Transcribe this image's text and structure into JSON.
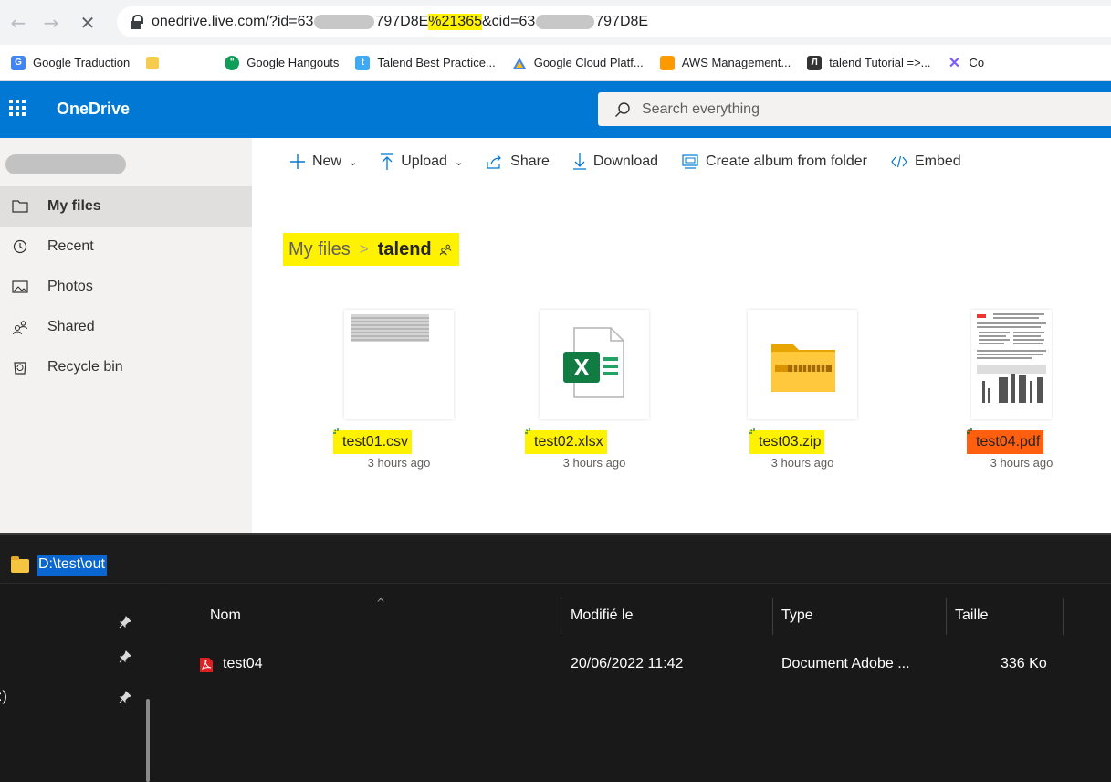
{
  "browser": {
    "url_parts": {
      "prefix": "onedrive.live.com/?id=63",
      "mid": "797D8E",
      "highlight": "%21365",
      "cid": "&cid=63",
      "tail": "797D8E"
    },
    "bookmarks": [
      {
        "label": "Google Traduction",
        "icon": "translate-icon",
        "color": "#4285f4"
      },
      {
        "label": "Google Hangouts",
        "icon": "hangouts-icon",
        "color": "#0f9d58"
      },
      {
        "label": "Talend Best Practice...",
        "icon": "talend-icon",
        "color": "#3fa9f5"
      },
      {
        "label": "Google Cloud Platf...",
        "icon": "gcp-icon",
        "color": "#4285f4"
      },
      {
        "label": "AWS Management...",
        "icon": "aws-icon",
        "color": "#ff9900"
      },
      {
        "label": "talend Tutorial =>...",
        "icon": "tutorial-icon",
        "color": "#333333"
      },
      {
        "label": "Co",
        "icon": "bookmark-icon",
        "color": "#7b5cff"
      }
    ]
  },
  "onedrive": {
    "brand": "OneDrive",
    "search_placeholder": "Search everything",
    "nav": [
      {
        "label": "My files",
        "icon": "folder-icon",
        "active": true
      },
      {
        "label": "Recent",
        "icon": "clock-icon",
        "active": false
      },
      {
        "label": "Photos",
        "icon": "photo-icon",
        "active": false
      },
      {
        "label": "Shared",
        "icon": "shared-icon",
        "active": false
      },
      {
        "label": "Recycle bin",
        "icon": "recycle-bin-icon",
        "active": false
      }
    ],
    "commands": {
      "new": "New",
      "upload": "Upload",
      "share": "Share",
      "download": "Download",
      "album": "Create album from folder",
      "embed": "Embed"
    },
    "breadcrumb": {
      "root": "My files",
      "current": "talend"
    },
    "files": [
      {
        "name": "test01.csv",
        "modified": "3 hours ago",
        "kind": "csv",
        "highlight": "yellow"
      },
      {
        "name": "test02.xlsx",
        "modified": "3 hours ago",
        "kind": "xlsx",
        "highlight": "yellow"
      },
      {
        "name": "test03.zip",
        "modified": "3 hours ago",
        "kind": "zip",
        "highlight": "yellow"
      },
      {
        "name": "test04.pdf",
        "modified": "3 hours ago",
        "kind": "pdf",
        "highlight": "orange"
      }
    ]
  },
  "explorer": {
    "path": "D:\\test\\out",
    "columns": {
      "name": "Nom",
      "modified": "Modifié le",
      "type": "Type",
      "size": "Taille"
    },
    "rows": [
      {
        "name": "test04",
        "modified": "20/06/2022 11:42",
        "type": "Document Adobe ...",
        "size": "336 Ko"
      }
    ],
    "side_text": ":)"
  }
}
